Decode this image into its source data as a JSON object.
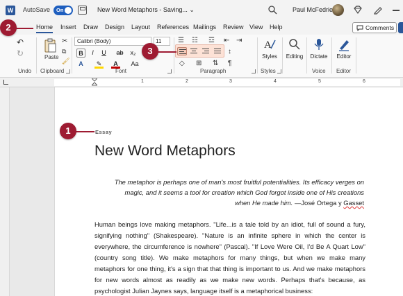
{
  "titlebar": {
    "autosave_label": "AutoSave",
    "autosave_state": "On",
    "document_title": "New Word Metaphors - Saving...",
    "title_caret": "⌄",
    "user_name": "Paul McFedries"
  },
  "tabs": [
    "Home",
    "Insert",
    "Draw",
    "Design",
    "Layout",
    "References",
    "Mailings",
    "Review",
    "View",
    "Help"
  ],
  "active_tab": "Home",
  "comments_label": "Comments",
  "ribbon": {
    "undo_label": "Undo",
    "clipboard": {
      "paste_label": "Paste",
      "group_label": "Clipboard"
    },
    "font": {
      "font_name": "Calibri (Body)",
      "font_size": "11",
      "group_label": "Font",
      "bold": "B",
      "italic": "I",
      "underline": "U",
      "strike": "ab",
      "subscript": "x₂",
      "change_case": "Aa"
    },
    "paragraph": {
      "group_label": "Paragraph"
    },
    "styles": {
      "label": "Styles",
      "group_label": "Styles"
    },
    "editing_label": "Editing",
    "voice": {
      "dictate_label": "Dictate",
      "group_label": "Voice"
    },
    "editor": {
      "label": "Editor",
      "group_label": "Editor"
    }
  },
  "ruler": {
    "numbers": [
      "1",
      "2",
      "3",
      "4",
      "5",
      "6"
    ]
  },
  "document": {
    "label": "Essay",
    "heading": "New Word Metaphors",
    "epigraph_text": "The metaphor is perhaps one of man's most fruitful potentialities. Its efficacy verges on magic, and it seems a tool for creation which God forgot inside one of His creations when He made him.",
    "epigraph_attrib_prefix": " —José Ortega y ",
    "epigraph_attrib_surname": "Gasset",
    "body": "Human beings love making metaphors. \"Life...is a tale told by an idiot, full of sound a fury, signifying nothing\" (Shakespeare). \"Nature is an infinite sphere in which the center is everywhere, the circumference is nowhere\" (Pascal). \"If Love Were Oil, I'd Be A Quart Low\" (country song title). We make metaphors for many things, but when we make many metaphors for one thing, it's a sign that that thing is important to us. And we make metaphors for new words almost as readily as we make new words. Perhaps that's because, as psychologist Julian Jaynes says, language itself is a metaphorical business:"
  },
  "callouts": [
    "1",
    "2",
    "3"
  ],
  "colors": {
    "accent": "#2b579a",
    "callout": "#9e1b32",
    "highlight": "#fde2d6"
  }
}
